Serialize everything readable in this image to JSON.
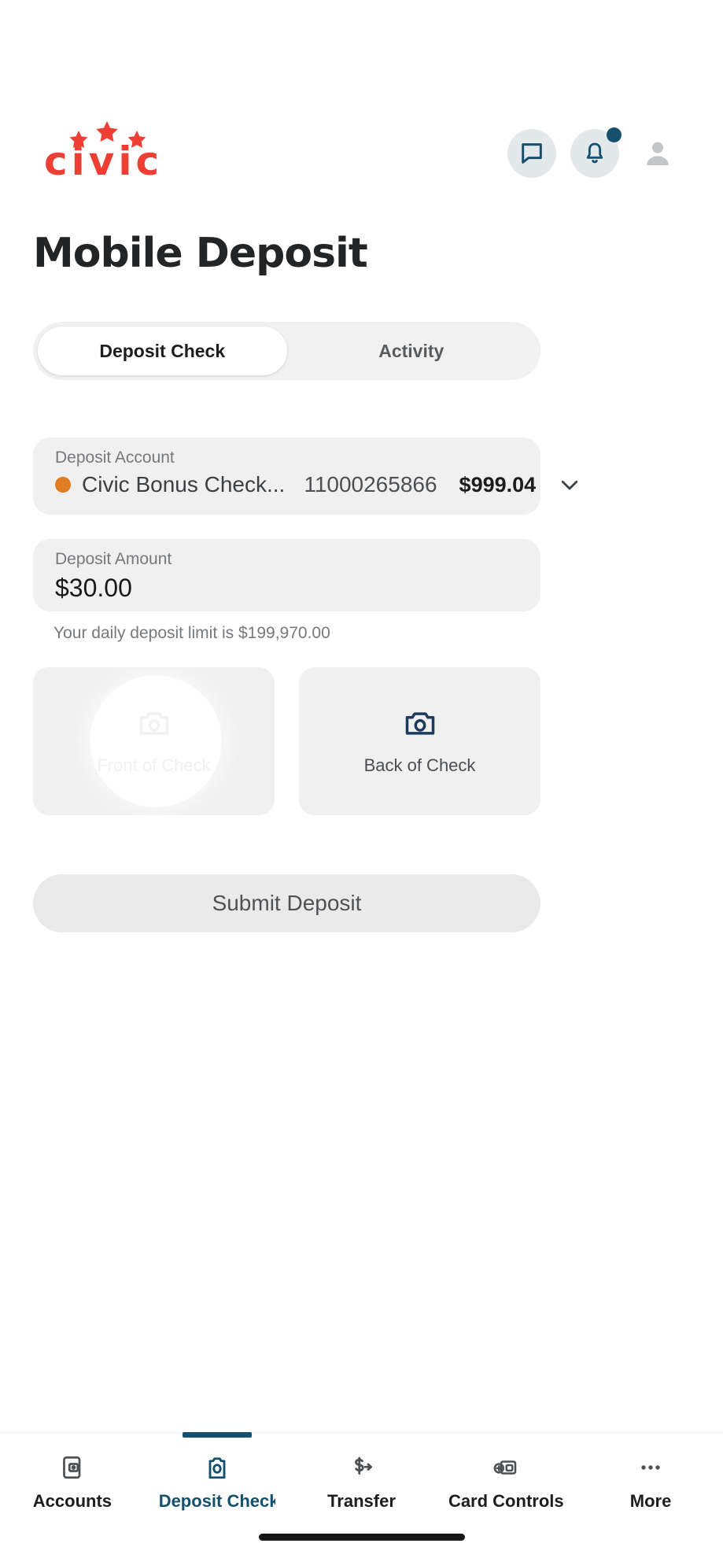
{
  "header": {
    "logo_text": "civic",
    "logo_color": "#ef3e33",
    "icon_color": "#15506e",
    "messages_icon": "message-bubble-icon",
    "notifications_icon": "bell-icon",
    "profile_icon": "person-avatar-icon",
    "has_notification_badge": true
  },
  "page": {
    "title": "Mobile Deposit"
  },
  "tabs": [
    {
      "label": "Deposit Check",
      "active": true
    },
    {
      "label": "Activity",
      "active": false
    }
  ],
  "account_field": {
    "label": "Deposit Account",
    "dot_color": "#e07b20",
    "name": "Civic Bonus Check...",
    "number": "11000265866",
    "balance": "$999.04",
    "chevron_icon": "chevron-down-icon"
  },
  "amount_field": {
    "label": "Deposit Amount",
    "value": "$30.00",
    "helper": "Your daily deposit limit is $199,970.00"
  },
  "capture": {
    "front": {
      "label": "Front of Check",
      "icon": "camera-icon"
    },
    "back": {
      "label": "Back of Check",
      "icon": "camera-icon"
    }
  },
  "submit": {
    "label": "Submit Deposit"
  },
  "bottom_nav": {
    "active_color": "#14506e",
    "items": [
      {
        "label": "Accounts",
        "icon": "account-card-icon",
        "active": false
      },
      {
        "label": "Deposit Check",
        "icon": "camera-check-icon",
        "active": true
      },
      {
        "label": "Transfer",
        "icon": "dollar-arrow-icon",
        "active": false
      },
      {
        "label": "Card Controls",
        "icon": "card-plus-icon",
        "active": false
      },
      {
        "label": "More",
        "icon": "ellipsis-icon",
        "active": false
      }
    ]
  }
}
